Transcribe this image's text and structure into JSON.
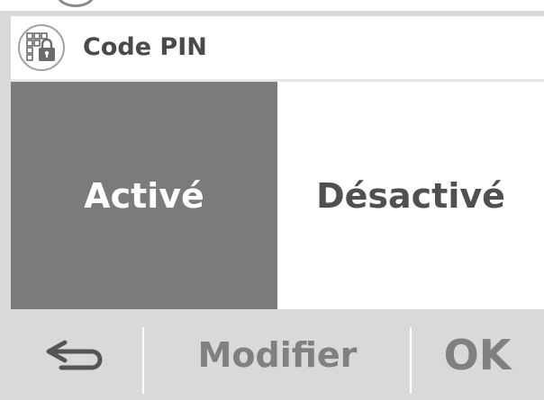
{
  "header": {
    "icon": "pin-lock-icon",
    "title": "Code PIN"
  },
  "options": [
    {
      "label": "Activé",
      "selected": true
    },
    {
      "label": "Désactivé",
      "selected": false
    }
  ],
  "softkeys": {
    "back_icon": "return-arrow-icon",
    "modify_label": "Modifier",
    "ok_label": "OK"
  },
  "colors": {
    "selected_bg": "#7b7b7b",
    "footer_bg": "#d9d9d9",
    "text_gray": "#808080"
  }
}
